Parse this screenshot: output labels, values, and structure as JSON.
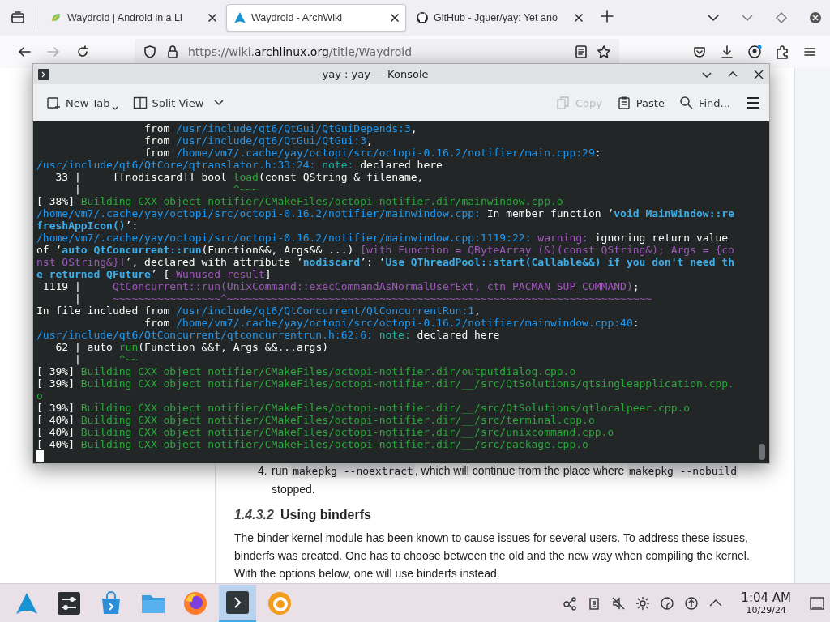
{
  "browser": {
    "tabs": [
      {
        "title": "Waydroid | Android in a Li",
        "kind": "waydroid",
        "selected": false
      },
      {
        "title": "Waydroid - ArchWiki",
        "kind": "arch",
        "selected": true
      },
      {
        "title": "GitHub - Jguer/yay: Yet ano",
        "kind": "github",
        "selected": false
      }
    ],
    "forward_disabled": true,
    "address": {
      "prefix": "https://wiki.",
      "domain": "archlinux.org",
      "path": "/title/Waydroid"
    }
  },
  "konsole": {
    "title": "yay : yay — Konsole",
    "toolbar_left": [
      {
        "label": "New Tab",
        "kind": "new-tab",
        "disabled": false
      },
      {
        "label": "Split View",
        "kind": "split-view",
        "disabled": false
      }
    ],
    "toolbar_right": [
      {
        "label": "Copy",
        "kind": "copy",
        "disabled": true
      },
      {
        "label": "Paste",
        "kind": "paste",
        "disabled": false
      },
      {
        "label": "Find...",
        "kind": "find",
        "disabled": false
      }
    ],
    "lines": [
      [
        {
          "kind": "plain",
          "text": "                 from "
        },
        {
          "kind": "path",
          "text": "/usr/include/qt6/QtGui/QtGuiDepends:3"
        },
        {
          "kind": "plain",
          "text": ","
        }
      ],
      [
        {
          "kind": "plain",
          "text": "                 from "
        },
        {
          "kind": "path",
          "text": "/usr/include/qt6/QtGui/QtGui:3"
        },
        {
          "kind": "plain",
          "text": ","
        }
      ],
      [
        {
          "kind": "plain",
          "text": "                 from "
        },
        {
          "kind": "path",
          "text": "/home/vm7/.cache/yay/octopi/src/octopi-0.16.2/notifier/main.cpp:29"
        },
        {
          "kind": "plain",
          "text": ":"
        }
      ],
      [
        {
          "kind": "path",
          "text": "/usr/include/qt6/QtCore/qtranslator.h:33:24: "
        },
        {
          "kind": "note",
          "text": "note:"
        },
        {
          "kind": "plain",
          "text": " declared here"
        }
      ],
      [
        {
          "kind": "plain",
          "text": "   33 |     [[nodiscard]] bool "
        },
        {
          "kind": "success",
          "text": "load"
        },
        {
          "kind": "plain",
          "text": "(const QString & filename,"
        }
      ],
      [
        {
          "kind": "plain",
          "text": "      |                        "
        },
        {
          "kind": "success",
          "text": "^~~~"
        }
      ],
      [
        {
          "kind": "plain",
          "text": "[ 38%] "
        },
        {
          "kind": "success",
          "text": "Building CXX object notifier/CMakeFiles/octopi-notifier.dir/mainwindow.cpp.o"
        }
      ],
      [
        {
          "kind": "path",
          "text": "/home/vm7/.cache/yay/octopi/src/octopi-0.16.2/notifier/mainwindow.cpp:"
        },
        {
          "kind": "plain",
          "text": " In member function ‘"
        },
        {
          "kind": "quote",
          "text": "void MainWindow::re"
        }
      ],
      [
        {
          "kind": "quote",
          "text": "freshAppIcon()"
        },
        {
          "kind": "plain",
          "text": "’:"
        }
      ],
      [
        {
          "kind": "path",
          "text": "/home/vm7/.cache/yay/octopi/src/octopi-0.16.2/notifier/mainwindow.cpp:1119:22: "
        },
        {
          "kind": "warning",
          "text": "warning:"
        },
        {
          "kind": "plain",
          "text": " ignoring return value"
        }
      ],
      [
        {
          "kind": "plain",
          "text": "of ‘"
        },
        {
          "kind": "quote",
          "text": "auto QtConcurrent::run"
        },
        {
          "kind": "plain",
          "text": "(Function&&, Args&& ...) "
        },
        {
          "kind": "hint",
          "text": "[with Function = QByteArray (&)(const QString&); Args = {co"
        }
      ],
      [
        {
          "kind": "hint",
          "text": "nst QString&}]"
        },
        {
          "kind": "plain",
          "text": "’, declared with attribute ‘"
        },
        {
          "kind": "quote",
          "text": "nodiscard"
        },
        {
          "kind": "plain",
          "text": "’: ‘"
        },
        {
          "kind": "quote",
          "text": "Use QThreadPool::start(Callable&&) if you don't need th"
        }
      ],
      [
        {
          "kind": "quote",
          "text": "e returned QFuture"
        },
        {
          "kind": "plain",
          "text": "’ ["
        },
        {
          "kind": "hint",
          "text": "-Wunused-result"
        },
        {
          "kind": "plain",
          "text": "]"
        }
      ],
      [
        {
          "kind": "plain",
          "text": " 1119 |     "
        },
        {
          "kind": "hint",
          "text": "QtConcurrent::run(UnixCommand::execCommandAsNormalUserExt, ctn_PACMAN_SUP_COMMAND)"
        },
        {
          "kind": "plain",
          "text": ";"
        }
      ],
      [
        {
          "kind": "plain",
          "text": "      |     "
        },
        {
          "kind": "hint",
          "text": "~~~~~~~~~~~~~~~~~^~~~~~~~~~~~~~~~~~~~~~~~~~~~~~~~~~~~~~~~~~~~~~~~~~~~~~~~~~~~~~~~~~~~"
        }
      ],
      [
        {
          "kind": "plain",
          "text": "In file included from "
        },
        {
          "kind": "path",
          "text": "/usr/include/qt6/QtConcurrent/QtConcurrentRun:1"
        },
        {
          "kind": "plain",
          "text": ","
        }
      ],
      [
        {
          "kind": "plain",
          "text": "                 from "
        },
        {
          "kind": "path",
          "text": "/home/vm7/.cache/yay/octopi/src/octopi-0.16.2/notifier/mainwindow.cpp:40"
        },
        {
          "kind": "plain",
          "text": ":"
        }
      ],
      [
        {
          "kind": "path",
          "text": "/usr/include/qt6/QtConcurrent/qtconcurrentrun.h:62:6: "
        },
        {
          "kind": "note",
          "text": "note:"
        },
        {
          "kind": "plain",
          "text": " declared here"
        }
      ],
      [
        {
          "kind": "plain",
          "text": "   62 | auto "
        },
        {
          "kind": "success",
          "text": "run"
        },
        {
          "kind": "plain",
          "text": "(Function &&f, Args &&...args)"
        }
      ],
      [
        {
          "kind": "plain",
          "text": "      |      "
        },
        {
          "kind": "success",
          "text": "^~~"
        }
      ],
      [
        {
          "kind": "plain",
          "text": "[ 39%] "
        },
        {
          "kind": "success",
          "text": "Building CXX object notifier/CMakeFiles/octopi-notifier.dir/outputdialog.cpp.o"
        }
      ],
      [
        {
          "kind": "plain",
          "text": "[ 39%] "
        },
        {
          "kind": "success",
          "text": "Building CXX object notifier/CMakeFiles/octopi-notifier.dir/__/src/QtSolutions/qtsingleapplication.cpp."
        }
      ],
      [
        {
          "kind": "success",
          "text": "o"
        }
      ],
      [
        {
          "kind": "plain",
          "text": "[ 39%] "
        },
        {
          "kind": "success",
          "text": "Building CXX object notifier/CMakeFiles/octopi-notifier.dir/__/src/QtSolutions/qtlocalpeer.cpp.o"
        }
      ],
      [
        {
          "kind": "plain",
          "text": "[ 40%] "
        },
        {
          "kind": "success",
          "text": "Building CXX object notifier/CMakeFiles/octopi-notifier.dir/__/src/terminal.cpp.o"
        }
      ],
      [
        {
          "kind": "plain",
          "text": "[ 40%] "
        },
        {
          "kind": "success",
          "text": "Building CXX object notifier/CMakeFiles/octopi-notifier.dir/__/src/unixcommand.cpp.o"
        }
      ],
      [
        {
          "kind": "plain",
          "text": "[ 40%] "
        },
        {
          "kind": "success",
          "text": "Building CXX object notifier/CMakeFiles/octopi-notifier.dir/__/src/package.cpp.o"
        }
      ]
    ]
  },
  "page": {
    "list_item": {
      "number": "4.",
      "segments": [
        {
          "kind": "text",
          "text": "run "
        },
        {
          "kind": "code",
          "text": "makepkg --noextract"
        },
        {
          "kind": "text",
          "text": ", which will continue from the place where "
        },
        {
          "kind": "code",
          "text": "makepkg --nobuild"
        },
        {
          "kind": "text",
          "text": " stopped."
        }
      ]
    },
    "heading": {
      "number": "1.4.3.2",
      "title": "Using binderfs"
    },
    "paragraph": "The binder kernel module has been known to cause issues for several users. To address these issues, binderfs was created. One has to choose between the old and the new way when compiling the kernel. With the options below, one will use binderfs instead."
  },
  "taskbar": {
    "items": [
      {
        "kind": "launcher",
        "selected": false
      },
      {
        "kind": "settings",
        "selected": false
      },
      {
        "kind": "store",
        "selected": false
      },
      {
        "kind": "files",
        "selected": false
      },
      {
        "kind": "firefox",
        "selected": false
      },
      {
        "kind": "terminal",
        "selected": true
      },
      {
        "kind": "app",
        "selected": false
      }
    ],
    "clock": {
      "time": "1:04 AM",
      "date": "10/29/24"
    }
  }
}
